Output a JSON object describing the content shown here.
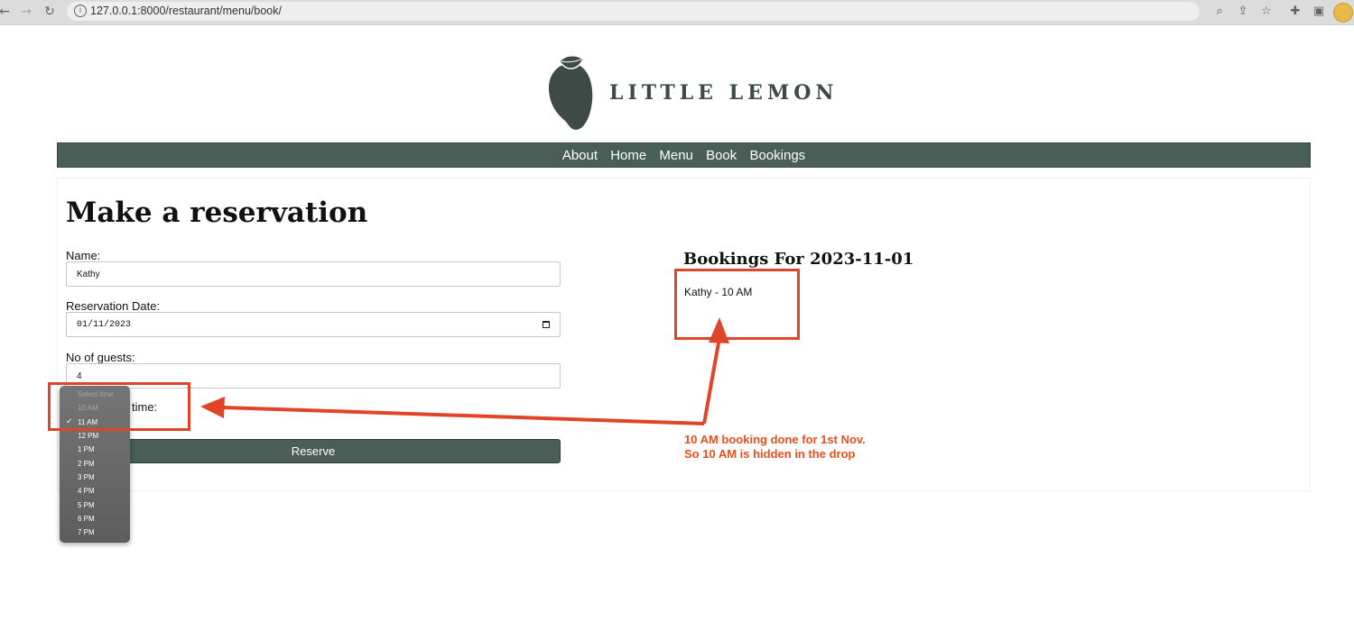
{
  "browser": {
    "url": "127.0.0.1:8000/restaurant/menu/book/",
    "icons": [
      "back-icon",
      "forward-icon",
      "reload-icon",
      "info-icon",
      "zoom-icon",
      "share-icon",
      "bookmark-star-icon",
      "extensions-icon",
      "side-panel-icon",
      "profile-avatar"
    ]
  },
  "site": {
    "brand": "LITTLE LEMON",
    "nav": [
      "About",
      "Home",
      "Menu",
      "Book",
      "Bookings"
    ]
  },
  "form": {
    "title": "Make a reservation",
    "name_label": "Name:",
    "name_value": "Kathy",
    "date_label": "Reservation Date:",
    "date_value": "01/11/2023",
    "guests_label": "No of guests:",
    "guests_value": "4",
    "time_label_visible": "time:",
    "reserve_label": "Reserve"
  },
  "dropdown": {
    "placeholder": "Select time",
    "selected": "11 AM",
    "options": [
      {
        "label": "10 AM",
        "disabled": true
      },
      {
        "label": "11 AM",
        "checked": true
      },
      {
        "label": "12 PM"
      },
      {
        "label": "1 PM"
      },
      {
        "label": "2 PM"
      },
      {
        "label": "3 PM"
      },
      {
        "label": "4 PM"
      },
      {
        "label": "5 PM"
      },
      {
        "label": "6 PM"
      },
      {
        "label": "7 PM"
      }
    ]
  },
  "bookings": {
    "title": "Bookings For 2023-11-01",
    "items": [
      "Kathy - 10 AM"
    ]
  },
  "annotation": {
    "line1": "10 AM booking done for 1st Nov.",
    "line2": "So 10 AM is hidden in the drop",
    "color": "#e0452a"
  },
  "colors": {
    "brand_green": "#495e57",
    "annotation_red": "#e0452a"
  }
}
